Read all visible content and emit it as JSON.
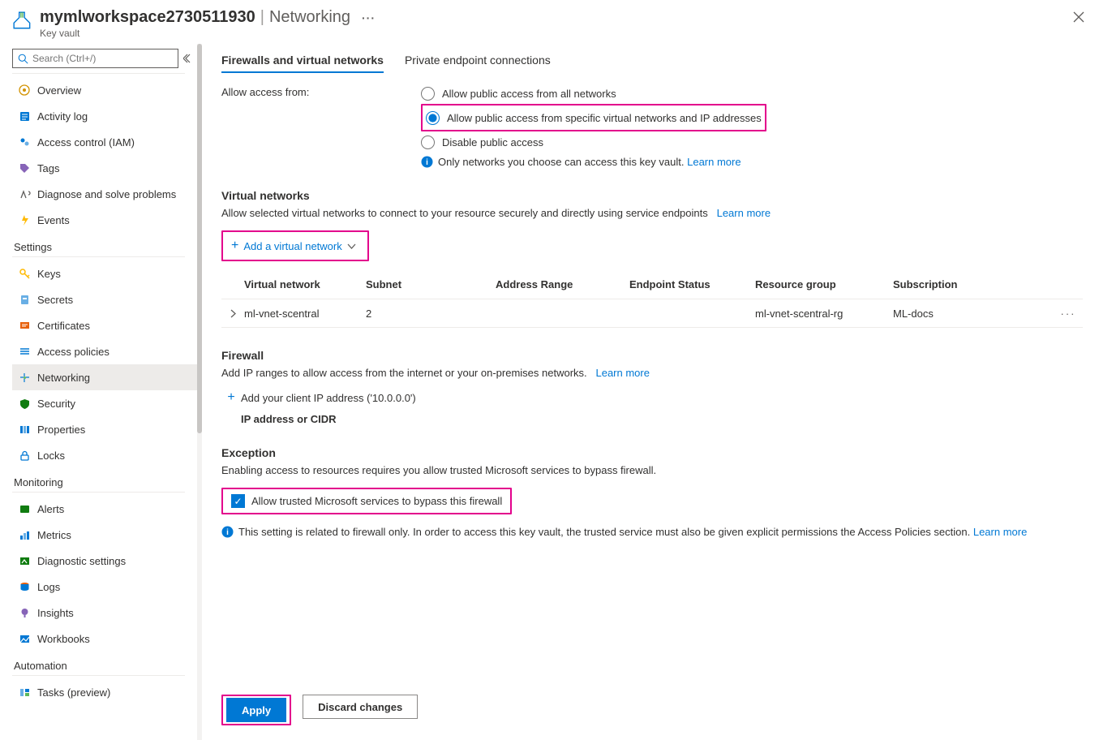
{
  "header": {
    "resource_name": "mymlworkspace2730511930",
    "page_name": "Networking",
    "type": "Key vault"
  },
  "sidebar": {
    "search_placeholder": "Search (Ctrl+/)",
    "top_items": [
      {
        "label": "Overview"
      },
      {
        "label": "Activity log"
      },
      {
        "label": "Access control (IAM)"
      },
      {
        "label": "Tags"
      },
      {
        "label": "Diagnose and solve problems"
      },
      {
        "label": "Events"
      }
    ],
    "settings_label": "Settings",
    "settings_items": [
      {
        "label": "Keys"
      },
      {
        "label": "Secrets"
      },
      {
        "label": "Certificates"
      },
      {
        "label": "Access policies"
      },
      {
        "label": "Networking"
      },
      {
        "label": "Security"
      },
      {
        "label": "Properties"
      },
      {
        "label": "Locks"
      }
    ],
    "monitoring_label": "Monitoring",
    "monitoring_items": [
      {
        "label": "Alerts"
      },
      {
        "label": "Metrics"
      },
      {
        "label": "Diagnostic settings"
      },
      {
        "label": "Logs"
      },
      {
        "label": "Insights"
      },
      {
        "label": "Workbooks"
      }
    ],
    "automation_label": "Automation",
    "automation_items": [
      {
        "label": "Tasks (preview)"
      }
    ]
  },
  "tabs": {
    "firewalls": "Firewalls and virtual networks",
    "private_endpoint": "Private endpoint connections"
  },
  "access": {
    "label": "Allow access from:",
    "opt_all": "Allow public access from all networks",
    "opt_specific": "Allow public access from specific virtual networks and IP addresses",
    "opt_disable": "Disable public access",
    "info": "Only networks you choose can access this key vault.",
    "learn_more": "Learn more"
  },
  "vnet": {
    "heading": "Virtual networks",
    "desc": "Allow selected virtual networks to connect to your resource securely and directly using service endpoints",
    "learn_more": "Learn more",
    "add_btn": "Add a virtual network",
    "cols": {
      "vn": "Virtual network",
      "sub": "Subnet",
      "ar": "Address Range",
      "ep": "Endpoint Status",
      "rg": "Resource group",
      "subs": "Subscription"
    },
    "row": {
      "vn": "ml-vnet-scentral",
      "sub": "2",
      "rg": "ml-vnet-scentral-rg",
      "subs": "ML-docs"
    }
  },
  "firewall": {
    "heading": "Firewall",
    "desc": "Add IP ranges to allow access from the internet or your on-premises networks.",
    "learn_more": "Learn more",
    "add_client_ip": "Add your client IP address ('10.0.0.0')",
    "cidr_label": "IP address or CIDR"
  },
  "exception": {
    "heading": "Exception",
    "desc": "Enabling access to resources requires you allow trusted Microsoft services to bypass firewall.",
    "chk_label": "Allow trusted Microsoft services to bypass this firewall",
    "footnote": "This setting is related to firewall only. In order to access this key vault, the trusted service must also be given explicit permissions the Access Policies section.",
    "learn_more": "Learn more"
  },
  "footer": {
    "apply": "Apply",
    "discard": "Discard changes"
  }
}
